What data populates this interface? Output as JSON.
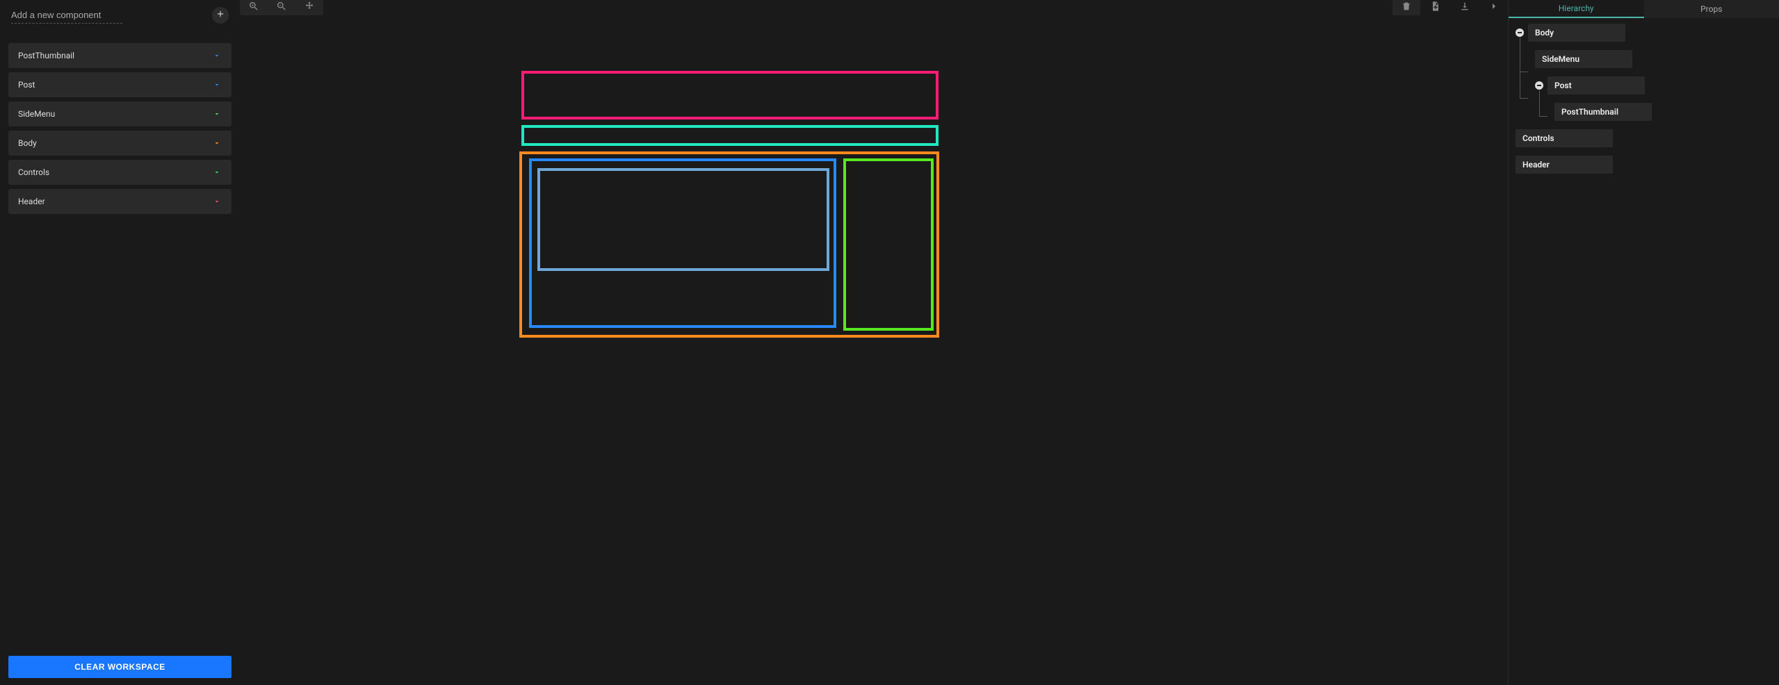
{
  "leftPanel": {
    "addPlaceholder": "Add a new component",
    "clearButton": "CLEAR WORKSPACE",
    "items": [
      {
        "name": "PostThumbnail",
        "chevronColor": "#2a88ff"
      },
      {
        "name": "Post",
        "chevronColor": "#2a88ff"
      },
      {
        "name": "SideMenu",
        "chevronColor": "#3fd66b"
      },
      {
        "name": "Body",
        "chevronColor": "#ff8a1f"
      },
      {
        "name": "Controls",
        "chevronColor": "#3fd66b"
      },
      {
        "name": "Header",
        "chevronColor": "#ff4d6d"
      }
    ]
  },
  "rightPanel": {
    "tabs": {
      "hierarchy": "Hierarchy",
      "props": "Props",
      "active": "hierarchy"
    },
    "tree": {
      "rows": [
        {
          "label": "Body",
          "indent": 0,
          "toggle": true
        },
        {
          "label": "SideMenu",
          "indent": 1,
          "toggle": false
        },
        {
          "label": "Post",
          "indent": 1,
          "toggle": true
        },
        {
          "label": "PostThumbnail",
          "indent": 2,
          "toggle": false
        },
        {
          "label": "Controls",
          "indent": 0,
          "toggle": false
        },
        {
          "label": "Header",
          "indent": 0,
          "toggle": false
        }
      ]
    }
  },
  "icons": {
    "zoomIn": "zoom-in-icon",
    "zoomOut": "zoom-out-icon",
    "move": "move-icon",
    "delete": "trash-icon",
    "new": "note-add-icon",
    "download": "download-icon",
    "collapse": "chevron-right-icon"
  }
}
